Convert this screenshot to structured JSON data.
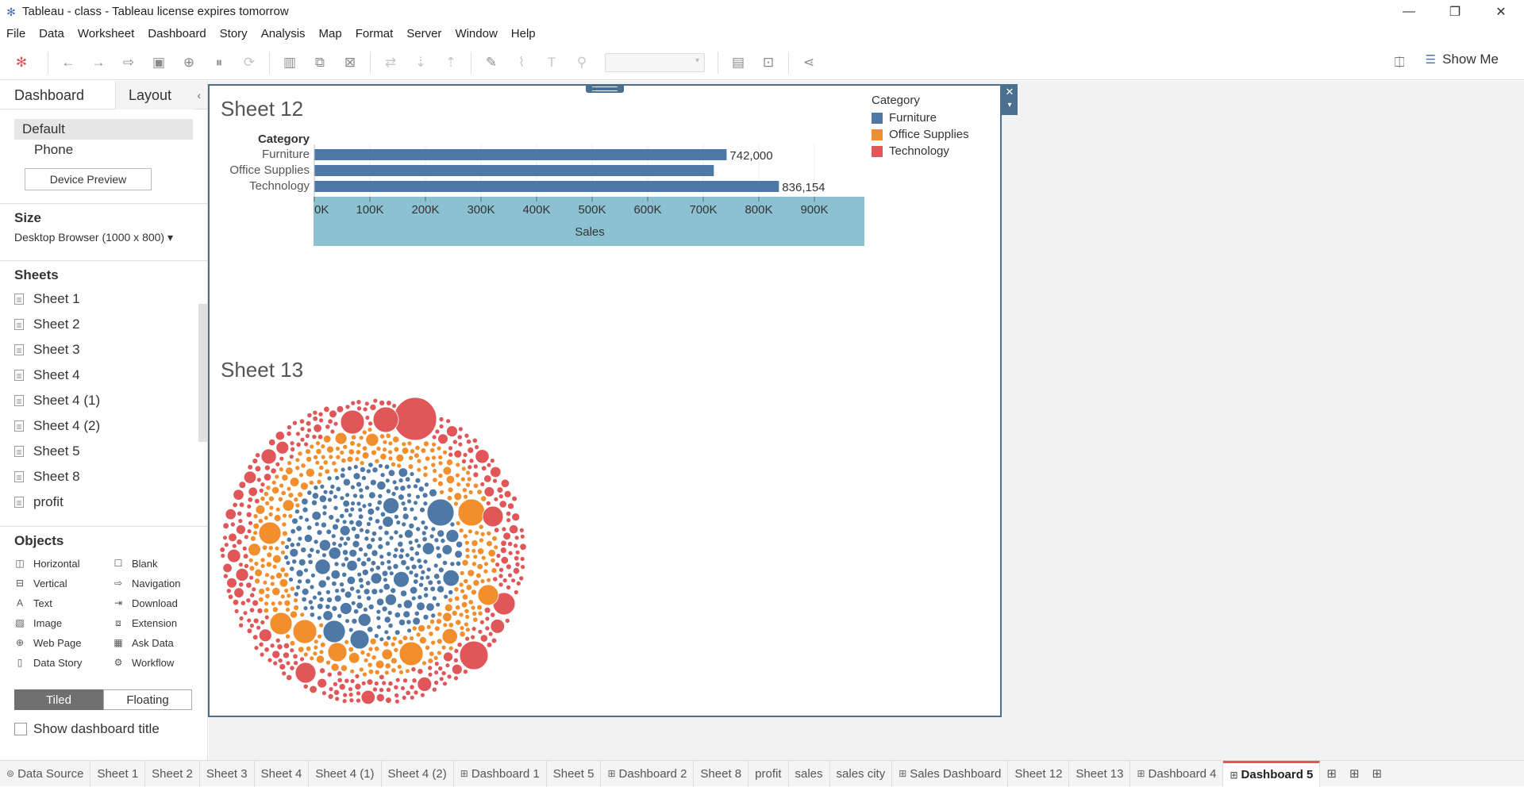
{
  "window": {
    "title": "Tableau - class - Tableau license expires tomorrow"
  },
  "menu": [
    "File",
    "Data",
    "Worksheet",
    "Dashboard",
    "Story",
    "Analysis",
    "Map",
    "Format",
    "Server",
    "Window",
    "Help"
  ],
  "toolbar": {
    "show_me": "Show Me"
  },
  "left_pane": {
    "tabs": {
      "dashboard": "Dashboard",
      "layout": "Layout"
    },
    "devices": [
      "Default",
      "Phone"
    ],
    "device_preview": "Device Preview",
    "size_header": "Size",
    "size_value": "Desktop Browser (1000 x 800) ▾",
    "sheets_header": "Sheets",
    "sheets": [
      "Sheet 1",
      "Sheet 2",
      "Sheet 3",
      "Sheet 4",
      "Sheet 4 (1)",
      "Sheet 4 (2)",
      "Sheet 5",
      "Sheet 8",
      "profit"
    ],
    "objects_header": "Objects",
    "objects": [
      {
        "label": "Horizontal",
        "icon": "horizontal-container-icon"
      },
      {
        "label": "Blank",
        "icon": "blank-icon"
      },
      {
        "label": "Vertical",
        "icon": "vertical-container-icon"
      },
      {
        "label": "Navigation",
        "icon": "navigation-icon"
      },
      {
        "label": "Text",
        "icon": "text-icon"
      },
      {
        "label": "Download",
        "icon": "download-icon"
      },
      {
        "label": "Image",
        "icon": "image-icon"
      },
      {
        "label": "Extension",
        "icon": "extension-icon"
      },
      {
        "label": "Web Page",
        "icon": "globe-icon"
      },
      {
        "label": "Ask Data",
        "icon": "ask-data-icon"
      },
      {
        "label": "Data Story",
        "icon": "data-story-icon"
      },
      {
        "label": "Workflow",
        "icon": "workflow-icon"
      }
    ],
    "tiled": "Tiled",
    "floating": "Floating",
    "show_dashboard_title": "Show dashboard title"
  },
  "dashboard": {
    "sheet12_title": "Sheet 12",
    "sheet13_title": "Sheet 13",
    "legend": {
      "title": "Category",
      "items": [
        {
          "label": "Furniture",
          "color": "#4e79a7"
        },
        {
          "label": "Office Supplies",
          "color": "#f28e2b"
        },
        {
          "label": "Technology",
          "color": "#e15759"
        }
      ]
    }
  },
  "chart_data": [
    {
      "type": "bar",
      "orientation": "horizontal",
      "row_header": "Category",
      "categories": [
        "Furniture",
        "Office Supplies",
        "Technology"
      ],
      "values": [
        742000,
        719047,
        836154
      ],
      "data_labels": [
        "742,000",
        "",
        "836,154"
      ],
      "xlabel": "Sales",
      "xlim": [
        0,
        960000
      ],
      "xticks": [
        "0K",
        "100K",
        "200K",
        "300K",
        "400K",
        "500K",
        "600K",
        "700K",
        "800K",
        "900K"
      ],
      "bar_color": "#4e79a7",
      "axis_highlight_color": "#8bc1d1"
    },
    {
      "type": "bubble",
      "layers": [
        {
          "category": "Furniture",
          "color": "#4e79a7",
          "position": "center"
        },
        {
          "category": "Office Supplies",
          "color": "#f28e2b",
          "position": "middle-ring"
        },
        {
          "category": "Technology",
          "color": "#e15759",
          "position": "outer-ring"
        }
      ]
    }
  ],
  "bottom_tabs": [
    {
      "label": "Data Source",
      "kind": "datasource"
    },
    {
      "label": "Sheet 1",
      "kind": "sheet"
    },
    {
      "label": "Sheet 2",
      "kind": "sheet"
    },
    {
      "label": "Sheet 3",
      "kind": "sheet"
    },
    {
      "label": "Sheet 4",
      "kind": "sheet"
    },
    {
      "label": "Sheet 4 (1)",
      "kind": "sheet"
    },
    {
      "label": "Sheet 4 (2)",
      "kind": "sheet"
    },
    {
      "label": "Dashboard 1",
      "kind": "dashboard"
    },
    {
      "label": "Sheet 5",
      "kind": "sheet"
    },
    {
      "label": "Dashboard 2",
      "kind": "dashboard"
    },
    {
      "label": "Sheet 8",
      "kind": "sheet"
    },
    {
      "label": "profit",
      "kind": "sheet"
    },
    {
      "label": "sales",
      "kind": "sheet"
    },
    {
      "label": "sales city",
      "kind": "sheet"
    },
    {
      "label": "Sales Dashboard",
      "kind": "dashboard"
    },
    {
      "label": "Sheet 12",
      "kind": "sheet"
    },
    {
      "label": "Sheet 13",
      "kind": "sheet"
    },
    {
      "label": "Dashboard 4",
      "kind": "dashboard"
    },
    {
      "label": "Dashboard 5",
      "kind": "dashboard",
      "active": true
    }
  ]
}
